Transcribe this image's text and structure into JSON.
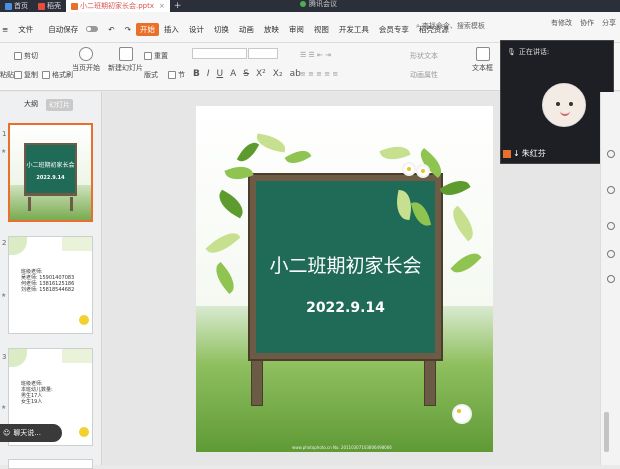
{
  "tabs": [
    {
      "label": "首页",
      "active": false
    },
    {
      "label": "稻壳",
      "active": false
    },
    {
      "label": "小二班期初家长会.pptx",
      "active": true
    }
  ],
  "meeting_label": "腾讯会议",
  "menu": {
    "file": "文件",
    "autosave": "自动保存",
    "items": [
      "开始",
      "插入",
      "设计",
      "切换",
      "动画",
      "放映",
      "审阅",
      "视图",
      "开发工具",
      "会员专享",
      "稻壳资源"
    ],
    "search_placeholder": "查找命令、搜索模板",
    "right_items": [
      "有修改",
      "协作",
      "分享"
    ]
  },
  "toolbar": {
    "cut": "剪切",
    "copy": "复制",
    "format_painter": "格式刷",
    "paste": "粘贴",
    "play_from_start": "当页开始",
    "new_slide": "新建幻灯片",
    "format": "版式",
    "section": "节",
    "reset": "重置",
    "text_box": "文本框",
    "convert": "转换",
    "text_extras": "形状文本",
    "animation_extras": "动画属性"
  },
  "left_panel": {
    "tab_outline": "大纲",
    "tab_slides": "幻灯片",
    "thumbs": [
      {
        "num": "1",
        "title": "小二班期初家长会",
        "date": "2022.9.14"
      },
      {
        "num": "2",
        "lines": "班级老师:\n吴老师: 15901407083\n何老师: 13816125186\n刘老师: 15818544682"
      },
      {
        "num": "3",
        "lines": "班级老师:\n本班幼儿数量:\n男生17人\n女生19人"
      }
    ],
    "chat_label": "聊天说..."
  },
  "slide": {
    "title": "小二班期初家长会",
    "date": "2022.9.14",
    "watermark": "www.photophoto.cn No. 20110307103806498066"
  },
  "video": {
    "speaking_label": "正在讲话:",
    "participant_name": "朱红芬"
  },
  "colors": {
    "accent": "#e8702a",
    "board": "#1f6b57",
    "titlebar": "#2b2f3a"
  }
}
